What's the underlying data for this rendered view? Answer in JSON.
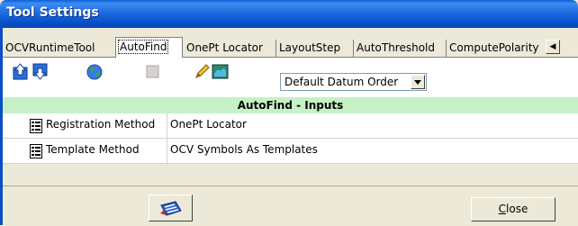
{
  "window": {
    "title": "Tool Settings"
  },
  "tabs": [
    {
      "label": "OCVRuntimeTool",
      "active": false
    },
    {
      "label": "AutoFind",
      "active": true
    },
    {
      "label": "OnePt Locator",
      "active": false
    },
    {
      "label": "LayoutStep",
      "active": false
    },
    {
      "label": "AutoThreshold",
      "active": false
    },
    {
      "label": "ComputePolarity",
      "active": false
    }
  ],
  "toolbar": {
    "datum_order": {
      "selected": "Default Datum Order"
    },
    "icons": [
      "move-up-icon",
      "move-down-icon",
      "globe-icon",
      "disabled-blank-icon",
      "edit-pencil-icon",
      "map-icon"
    ]
  },
  "section": {
    "title": "AutoFind - Inputs"
  },
  "properties": [
    {
      "name": "Registration Method",
      "value": "OnePt Locator"
    },
    {
      "name": "Template Method",
      "value": "OCV Symbols As Templates"
    }
  ],
  "footer": {
    "keyboard_icon": "keyboard-icon",
    "close_label_mnemonic": "C",
    "close_label_rest": "lose"
  },
  "colors": {
    "title_bar": "#0a5fd8",
    "section_header": "#c6f1c6",
    "dialog_bg": "#ece9d8"
  }
}
